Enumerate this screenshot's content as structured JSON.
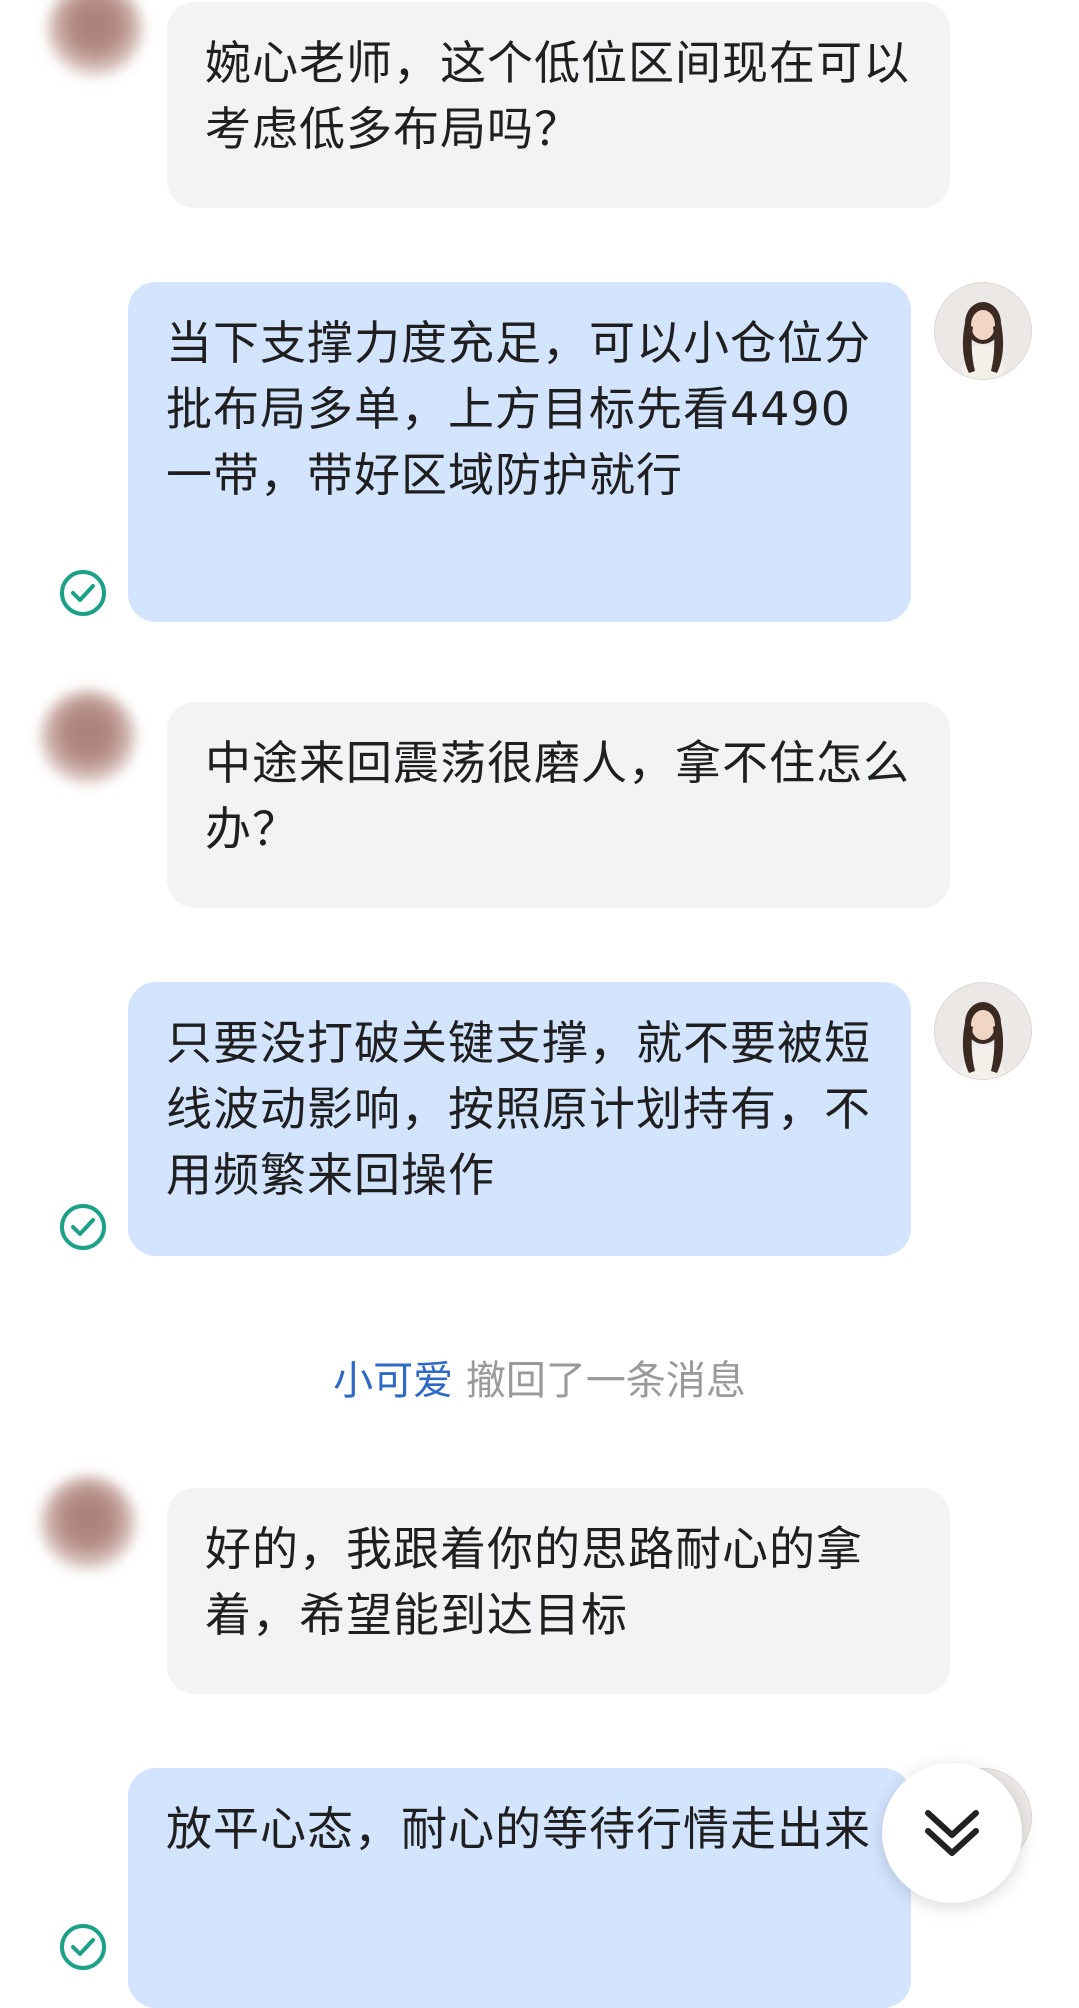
{
  "messages": [
    {
      "side": "in",
      "text": "婉心老师，这个低位区间现在可以考虑低多布局吗？"
    },
    {
      "side": "out",
      "text": "当下支撑力度充足，可以小仓位分批布局多单，上方目标先看4490一带，带好区域防护就行"
    },
    {
      "side": "in",
      "text": "中途来回震荡很磨人，拿不住怎么办？"
    },
    {
      "side": "out",
      "text": "只要没打破关键支撑，就不要被短线波动影响，按照原计划持有，不用频繁来回操作"
    },
    {
      "side": "in",
      "text": "好的，我跟着你的思路耐心的拿着，希望能到达目标"
    },
    {
      "side": "out",
      "text": "放平心态，耐心的等待行情走出来"
    }
  ],
  "recall_notice": {
    "name": "小可爱",
    "text": "撤回了一条消息"
  },
  "icons": {
    "read_check": "check-circle-icon",
    "scroll_down": "double-chevron-down-icon",
    "back": "back-arrow-icon"
  },
  "colors": {
    "outgoing_bubble": "#d3e4ff",
    "incoming_bubble": "#f2f3f5",
    "check": "#1aa188",
    "recall_name": "#2f69c6"
  }
}
